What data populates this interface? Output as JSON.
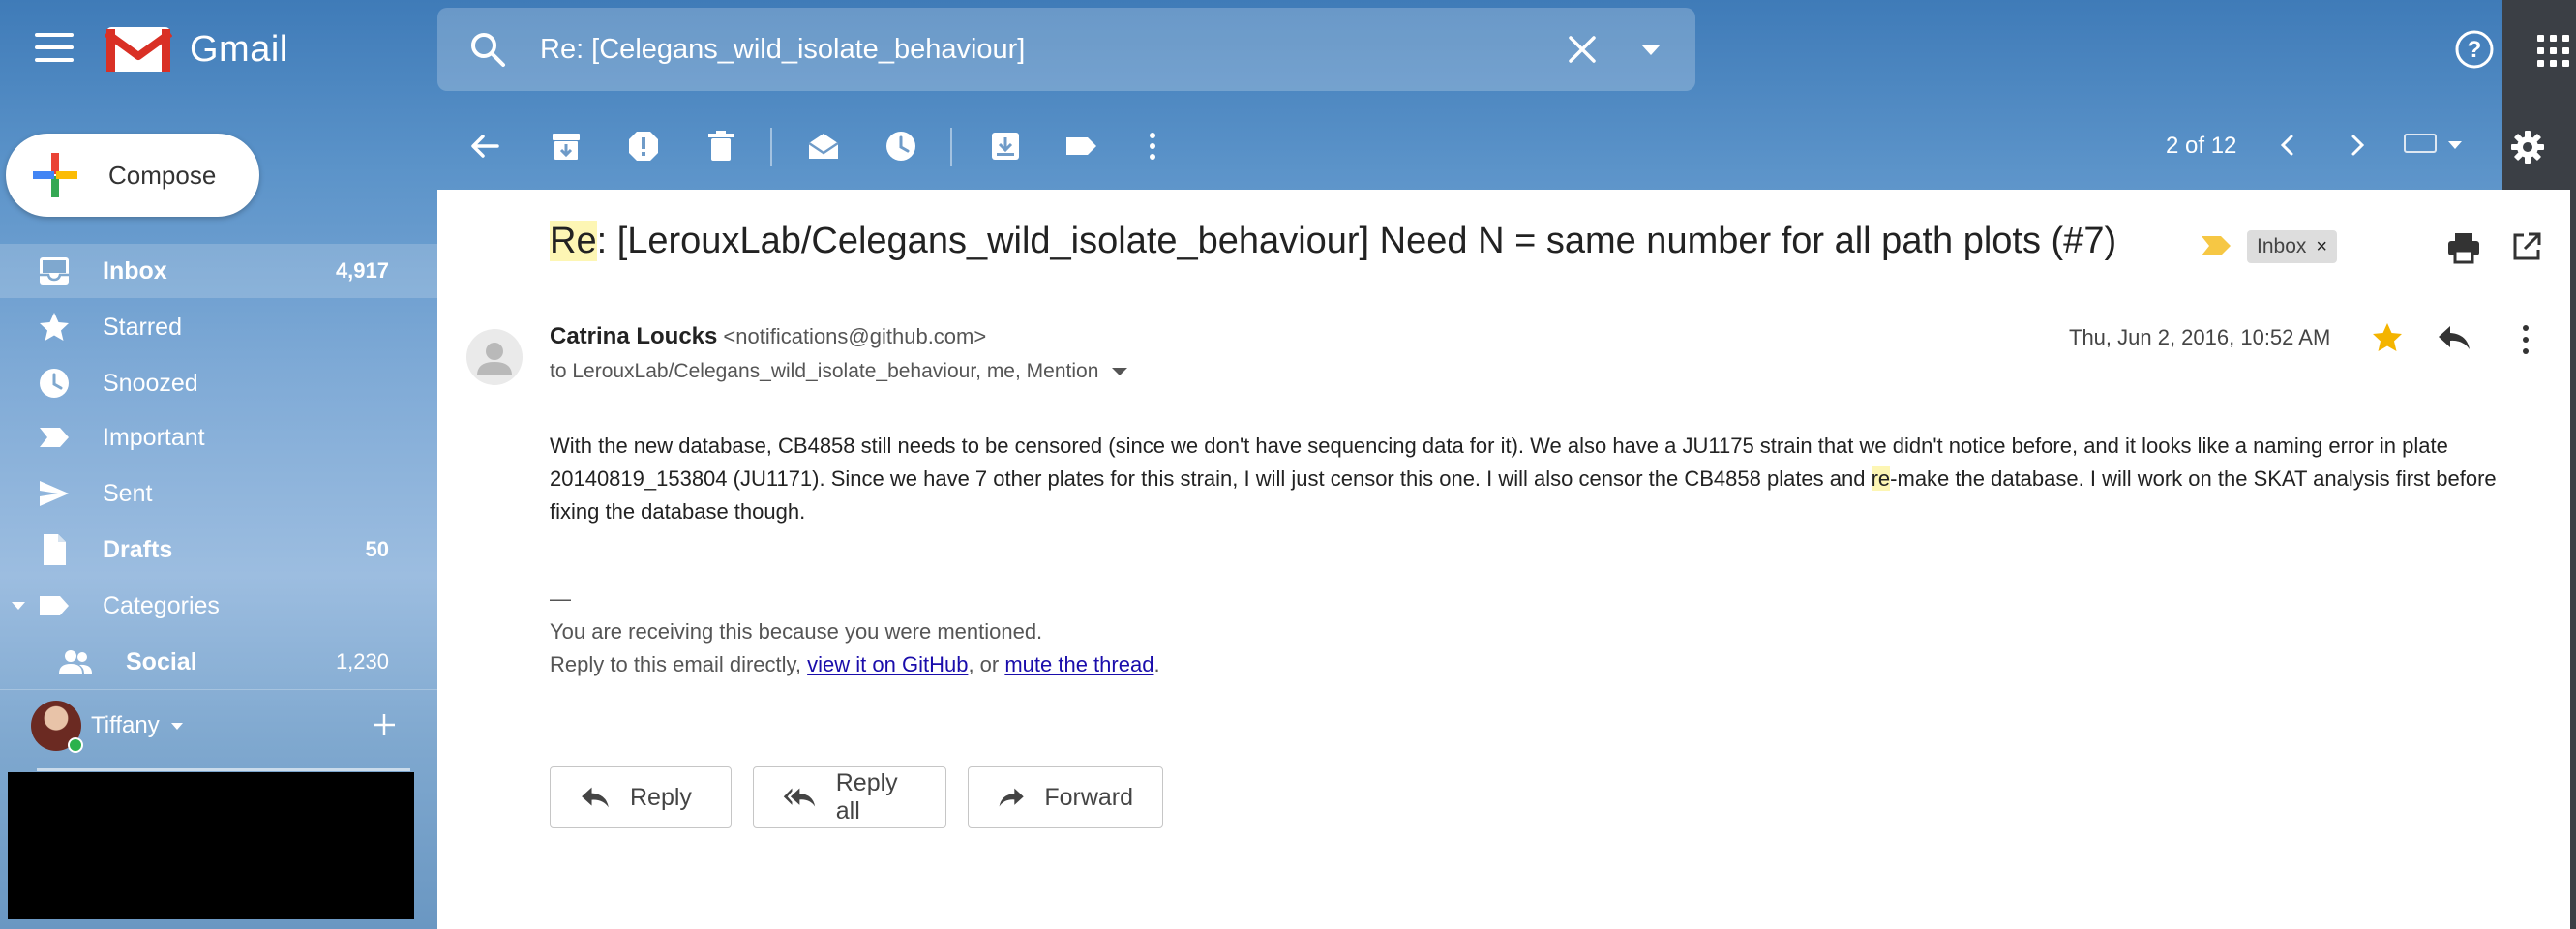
{
  "app": {
    "name": "Gmail"
  },
  "search": {
    "value": "Re: [Celegans_wild_isolate_behaviour]"
  },
  "toolbar": {
    "pager": "2 of 12"
  },
  "compose": {
    "label": "Compose"
  },
  "sidebar": {
    "items": [
      {
        "label": "Inbox",
        "count": "4,917",
        "icon": "inbox-icon"
      },
      {
        "label": "Starred",
        "count": "",
        "icon": "star-icon"
      },
      {
        "label": "Snoozed",
        "count": "",
        "icon": "clock-icon"
      },
      {
        "label": "Important",
        "count": "",
        "icon": "important-icon"
      },
      {
        "label": "Sent",
        "count": "",
        "icon": "send-icon"
      },
      {
        "label": "Drafts",
        "count": "50",
        "icon": "draft-icon"
      },
      {
        "label": "Categories",
        "count": "",
        "icon": "label-icon"
      },
      {
        "label": "Social",
        "count": "1,230",
        "icon": "people-icon"
      }
    ]
  },
  "user": {
    "name": "Tiffany"
  },
  "email": {
    "subject_prefix": "Re",
    "subject_rest": ": [LerouxLab/Celegans_wild_isolate_behaviour] Need N = same number for all path plots (#7)",
    "label": "Inbox",
    "label_remove": "×",
    "sender_name": "Catrina Loucks",
    "sender_email": "<notifications@github.com>",
    "recipients": "to LerouxLab/Celegans_wild_isolate_behaviour, me, Mention",
    "date": "Thu, Jun 2, 2016, 10:52 AM",
    "body_line1": "With the new database, CB4858 still needs to be censored (since we don't have sequencing data for it). We also have a JU1175 strain that we didn't notice before, and it looks like a naming error in plate",
    "body_line2a": "20140819_153804 (JU1171). Since we have 7 other plates for this strain, I will just censor this one. I will also censor the CB4858 plates and ",
    "body_line2_hl": "re",
    "body_line2b": "-make the database. I will work on the SKAT analysis first before fixing the database though.",
    "sig_dash": "—",
    "sig_line1": "You are receiving this because you were mentioned.",
    "sig_line2_pre": "Reply to this email directly, ",
    "sig_link1": "view it on GitHub",
    "sig_mid": ", or ",
    "sig_link2": "mute the thread",
    "sig_end": "."
  },
  "actions": {
    "reply": "Reply",
    "reply_all": "Reply all",
    "forward": "Forward"
  },
  "colors": {
    "accent_red": "#d93025",
    "star": "#f4b400",
    "important": "#f6c744",
    "link": "#1a0dab"
  }
}
